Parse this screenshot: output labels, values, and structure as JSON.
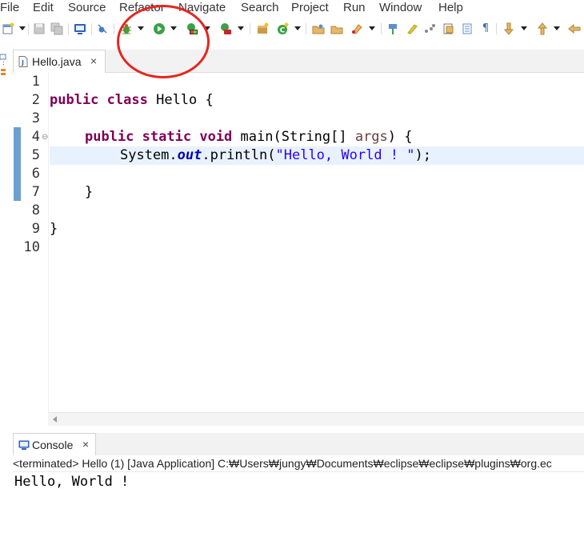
{
  "menu": {
    "items": [
      {
        "label": "File"
      },
      {
        "label": "Edit"
      },
      {
        "label": "Source"
      },
      {
        "label": "Refactor"
      },
      {
        "label": "Navigate"
      },
      {
        "label": "Search"
      },
      {
        "label": "Project"
      },
      {
        "label": "Run"
      },
      {
        "label": "Window"
      },
      {
        "label": "Help"
      }
    ]
  },
  "toolbar": {
    "icons": [
      "new-icon",
      "save-icon",
      "save-all-icon",
      "terminal-icon",
      "skip-breakpoints-icon",
      "debug-icon",
      "run-icon",
      "coverage-icon",
      "external-tools-icon",
      "new-java-package-icon",
      "new-java-class-icon",
      "open-type-icon",
      "open-task-icon",
      "search-icon",
      "toggle-mark-occurrences-icon",
      "show-whitespace-icon",
      "next-annotation-icon",
      "previous-annotation-icon",
      "back-icon"
    ],
    "annotation_color": "#e5261f"
  },
  "editor": {
    "tab_label": "Hello.java",
    "tab_close": "×",
    "line_numbers": [
      "1",
      "2",
      "3",
      "4",
      "5",
      "6",
      "7",
      "8",
      "9",
      "10"
    ],
    "code": {
      "line2": {
        "kw1": "public",
        "kw2": "class",
        "rest": " Hello {"
      },
      "line4": {
        "kw1": "public",
        "kw2": "static",
        "kw3": "void",
        "method": " main(String[] ",
        "param": "args",
        "end": ") {"
      },
      "line5": {
        "pre": "System.",
        "field": "out",
        "mid": ".println(",
        "string": "\"Hello, World ! \"",
        "end": ");"
      },
      "line7": "}",
      "line9": "}"
    },
    "highlighted_line": 5,
    "colors": {
      "keyword": "#7f0055",
      "string": "#2a00ff",
      "field": "#0000c0",
      "line_highlight": "#e8f2fe"
    }
  },
  "console": {
    "tab_label": "Console",
    "tab_close": "×",
    "status": "<terminated> Hello (1) [Java Application] C:₩Users₩jungy₩Documents₩eclipse₩eclipse₩plugins₩org.ec",
    "output": "Hello, World !"
  }
}
